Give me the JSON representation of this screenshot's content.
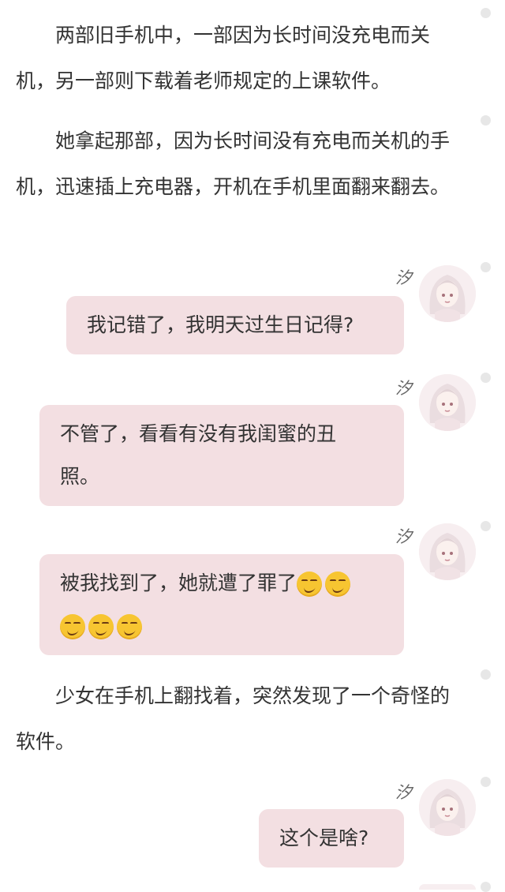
{
  "paragraphs": [
    "两部旧手机中，一部因为长时间没充电而关机，另一部则下载着老师规定的上课软件。",
    "她拿起那部，因为长时间没有充电而关机的手机，迅速插上充电器，开机在手机里面翻来翻去。",
    "少女在手机上翻找着，突然发现了一个奇怪的软件。"
  ],
  "messages": [
    {
      "sender": "汐",
      "text": "我记错了，我明天过生日记得?"
    },
    {
      "sender": "汐",
      "text_line1": "不管了，看看有没有我闺蜜的丑",
      "text_line2": "照。"
    },
    {
      "sender": "汐",
      "text": "被我找到了，她就遭了罪了",
      "emoji": "smirk-emoji"
    },
    {
      "sender": "汐",
      "text": "这个是啥?"
    }
  ]
}
